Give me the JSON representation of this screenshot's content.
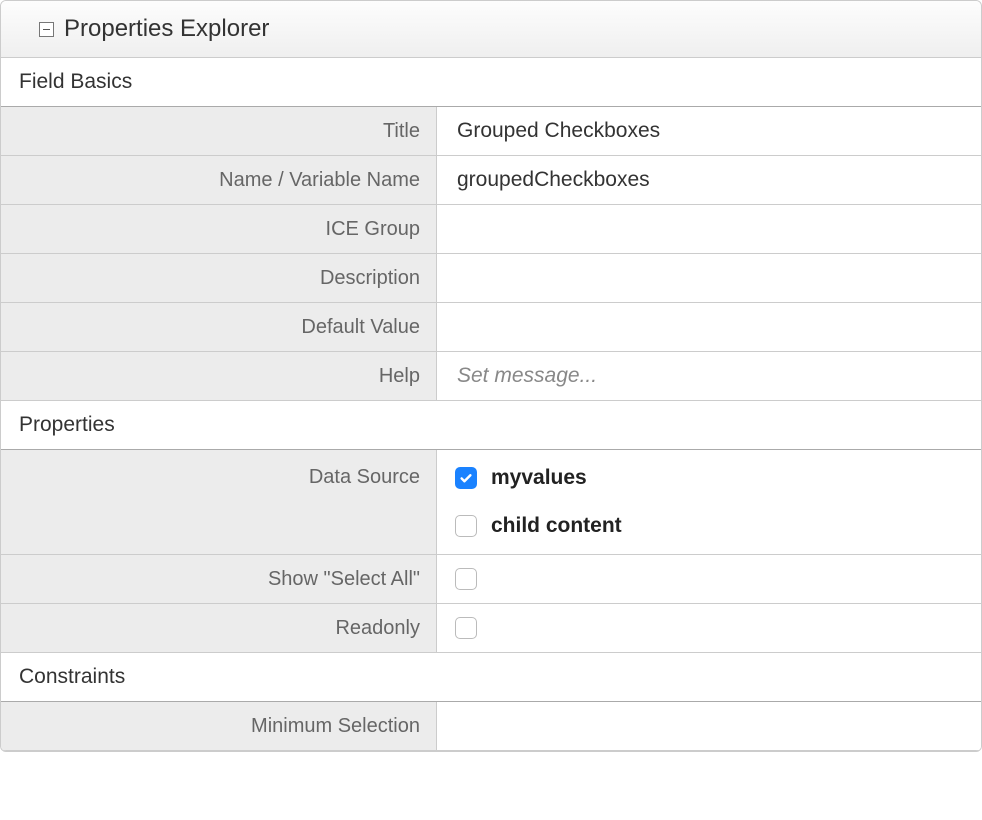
{
  "panel": {
    "title": "Properties Explorer"
  },
  "sections": {
    "basics": {
      "title": "Field Basics",
      "rows": {
        "title_label": "Title",
        "title_value": "Grouped Checkboxes",
        "name_label": "Name / Variable Name",
        "name_value": "groupedCheckboxes",
        "ice_label": "ICE Group",
        "ice_value": "",
        "desc_label": "Description",
        "desc_value": "",
        "default_label": "Default Value",
        "default_value": "",
        "help_label": "Help",
        "help_placeholder": "Set message..."
      }
    },
    "properties": {
      "title": "Properties",
      "rows": {
        "datasource_label": "Data Source",
        "datasource_options": [
          {
            "label": "myvalues",
            "checked": true
          },
          {
            "label": "child content",
            "checked": false
          }
        ],
        "selectall_label": "Show \"Select All\"",
        "selectall_checked": false,
        "readonly_label": "Readonly",
        "readonly_checked": false
      }
    },
    "constraints": {
      "title": "Constraints",
      "rows": {
        "minsel_label": "Minimum Selection",
        "minsel_value": ""
      }
    }
  }
}
